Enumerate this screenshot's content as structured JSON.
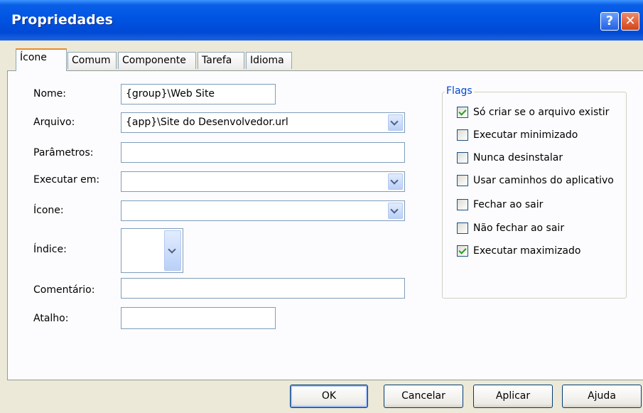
{
  "window": {
    "title": "Propriedades",
    "help_glyph": "?",
    "close_glyph": "✕"
  },
  "tabs": [
    {
      "label": "Ícone",
      "active": true
    },
    {
      "label": "Comum",
      "active": false
    },
    {
      "label": "Componente",
      "active": false
    },
    {
      "label": "Tarefa",
      "active": false
    },
    {
      "label": "Idioma",
      "active": false
    }
  ],
  "form": {
    "nome": {
      "label": "Nome:",
      "value": "{group}\\Web Site"
    },
    "arquivo": {
      "label": "Arquivo:",
      "value": "{app}\\Site do Desenvolvedor.url"
    },
    "parametros": {
      "label": "Parâmetros:",
      "value": ""
    },
    "executar_em": {
      "label": "Executar em:",
      "value": ""
    },
    "icone": {
      "label": "Ícone:",
      "value": ""
    },
    "indice": {
      "label": "Índice:",
      "value": ""
    },
    "comentario": {
      "label": "Comentário:",
      "value": ""
    },
    "atalho": {
      "label": "Atalho:",
      "value": ""
    }
  },
  "flags": {
    "title": "Flags",
    "items": [
      {
        "label": "Só criar se o arquivo existir",
        "checked": true
      },
      {
        "label": "Executar minimizado",
        "checked": false
      },
      {
        "label": "Nunca desinstalar",
        "checked": false
      },
      {
        "label": "Usar caminhos do aplicativo",
        "checked": false
      },
      {
        "label": "Fechar ao sair",
        "checked": false
      },
      {
        "label": "Não fechar ao sair",
        "checked": false
      },
      {
        "label": "Executar maximizado",
        "checked": true
      }
    ]
  },
  "buttons": {
    "ok": "OK",
    "cancelar": "Cancelar",
    "aplicar": "Aplicar",
    "ajuda": "Ajuda"
  },
  "colors": {
    "titlebar": "#0054e3",
    "face": "#ece9d8",
    "tab_accent": "#e68b2c",
    "check": "#21a121"
  }
}
